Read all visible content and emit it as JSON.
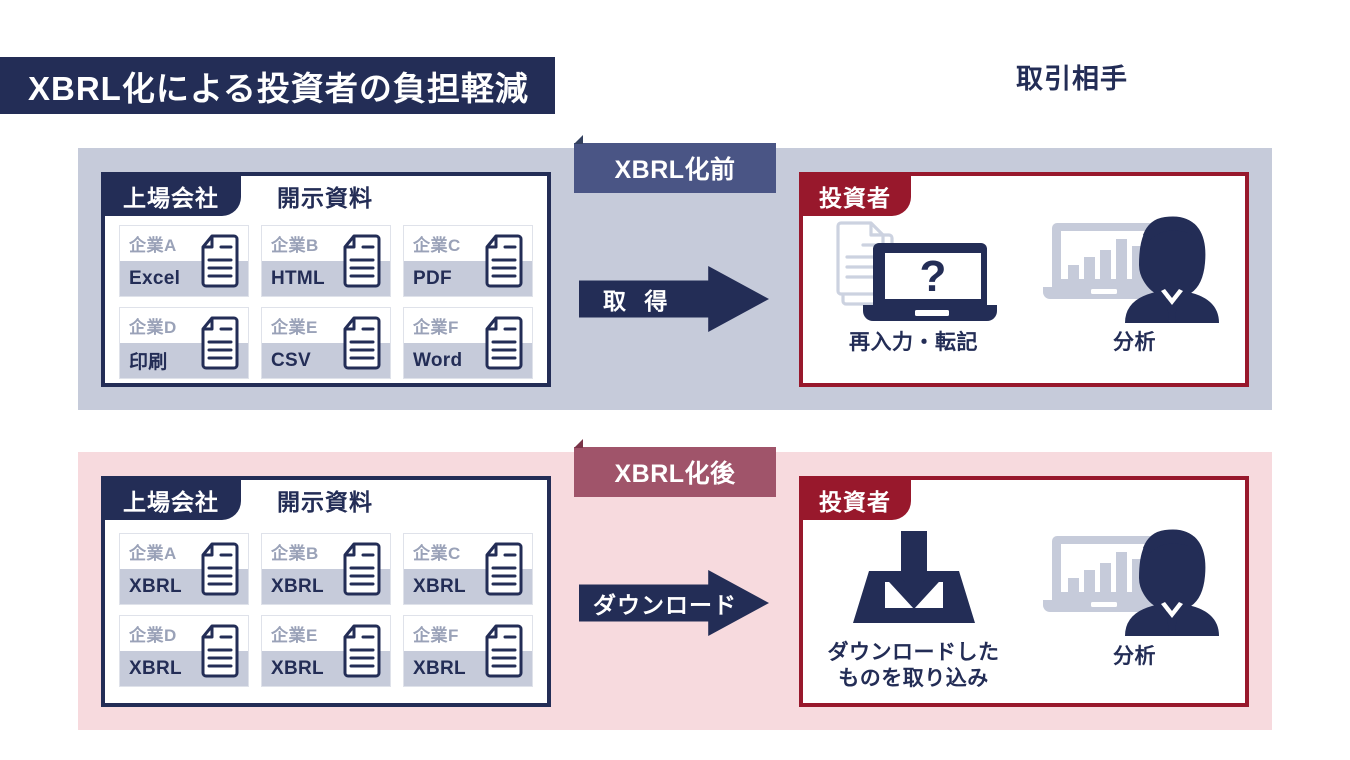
{
  "header": {
    "title": "XBRL化による投資者の負担軽減",
    "partner_label": "取引相手"
  },
  "colors": {
    "navy": "#232d56",
    "crimson": "#98182c",
    "slate_blue": "#4a5585",
    "mauve": "#a0546a",
    "band_gray": "#c6cbda",
    "band_pink": "#f7dade",
    "tile_label_gray": "#9aa2b8"
  },
  "rows": [
    {
      "id": "before",
      "phase_badge": "XBRL化前",
      "issuer": {
        "tab_label": "上場会社",
        "heading": "開示資料",
        "tiles": [
          {
            "company": "企業A",
            "format": "Excel"
          },
          {
            "company": "企業B",
            "format": "HTML"
          },
          {
            "company": "企業C",
            "format": "PDF"
          },
          {
            "company": "企業D",
            "format": "印刷"
          },
          {
            "company": "企業E",
            "format": "CSV"
          },
          {
            "company": "企業F",
            "format": "Word"
          }
        ]
      },
      "arrow_label": "取 得",
      "investor": {
        "tab_label": "投資者",
        "columns": [
          {
            "icon": "laptop-question-icon",
            "caption_lines": [
              "再入力・転記"
            ]
          },
          {
            "icon": "analyst-person-icon",
            "caption_lines": [
              "分析"
            ]
          }
        ]
      }
    },
    {
      "id": "after",
      "phase_badge": "XBRL化後",
      "issuer": {
        "tab_label": "上場会社",
        "heading": "開示資料",
        "tiles": [
          {
            "company": "企業A",
            "format": "XBRL"
          },
          {
            "company": "企業B",
            "format": "XBRL"
          },
          {
            "company": "企業C",
            "format": "XBRL"
          },
          {
            "company": "企業D",
            "format": "XBRL"
          },
          {
            "company": "企業E",
            "format": "XBRL"
          },
          {
            "company": "企業F",
            "format": "XBRL"
          }
        ]
      },
      "arrow_label": "ダウンロード",
      "investor": {
        "tab_label": "投資者",
        "columns": [
          {
            "icon": "download-tray-icon",
            "caption_lines": [
              "ダウンロードした",
              "ものを取り込み"
            ]
          },
          {
            "icon": "analyst-person-icon",
            "caption_lines": [
              "分析"
            ]
          }
        ]
      }
    }
  ]
}
